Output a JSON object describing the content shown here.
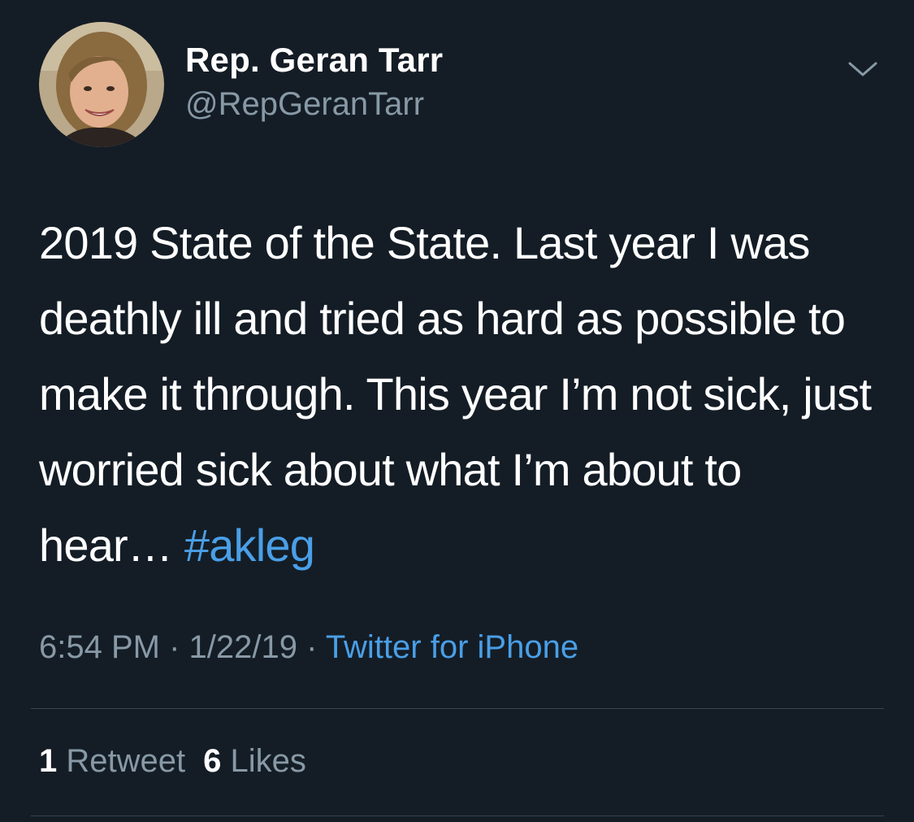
{
  "author": {
    "display_name": "Rep. Geran Tarr",
    "handle": "@RepGeranTarr",
    "avatar_icon": "profile-photo"
  },
  "tweet": {
    "text_parts": [
      "2019 State of the State. Last year I was deathly ill and tried as hard as possible to make it through. This year I’m not sick, just worried sick about what I’m about to hear… "
    ],
    "hashtag": "#akleg"
  },
  "meta": {
    "time": "6:54 PM",
    "separator": " · ",
    "date": "1/22/19",
    "source": "Twitter for iPhone"
  },
  "stats": {
    "retweets_count": "1",
    "retweets_label": "Retweet",
    "likes_count": "6",
    "likes_label": "Likes"
  },
  "icons": {
    "menu": "chevron-down-icon"
  },
  "colors": {
    "background": "#141d26",
    "primary_text": "#ffffff",
    "secondary_text": "#8899a6",
    "link": "#4a9fe7",
    "divider": "#38444d"
  }
}
